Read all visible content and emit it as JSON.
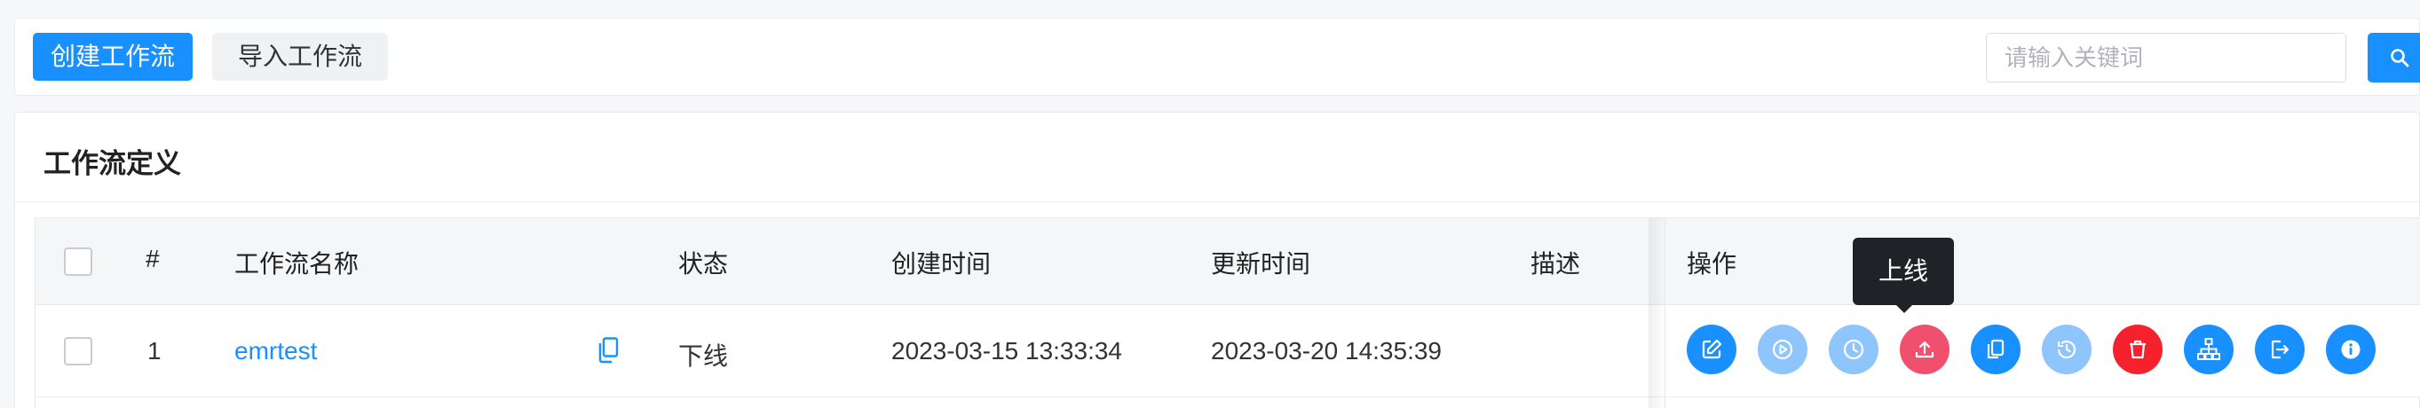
{
  "toolbar": {
    "create_label": "创建工作流",
    "import_label": "导入工作流",
    "search_placeholder": "请输入关键词",
    "search_value": ""
  },
  "card": {
    "title": "工作流定义"
  },
  "table": {
    "headers": {
      "index": "#",
      "name": "工作流名称",
      "status": "状态",
      "created": "创建时间",
      "updated": "更新时间",
      "description": "描述",
      "operations": "操作"
    },
    "rows": [
      {
        "index": "1",
        "name": "emrtest",
        "status": "下线",
        "created": "2023-03-15 13:33:34",
        "updated": "2023-03-20 14:35:39",
        "description": ""
      }
    ]
  },
  "operations": [
    {
      "name": "edit",
      "icon": "edit-icon",
      "color": "#1890ff"
    },
    {
      "name": "run",
      "icon": "play-icon",
      "color": "#8ec5fc"
    },
    {
      "name": "timing",
      "icon": "clock-icon",
      "color": "#8ec5fc"
    },
    {
      "name": "online",
      "icon": "upload-icon",
      "color": "#f0506e"
    },
    {
      "name": "copy",
      "icon": "copy-icon",
      "color": "#1890ff"
    },
    {
      "name": "version",
      "icon": "history-icon",
      "color": "#8ec5fc"
    },
    {
      "name": "delete",
      "icon": "trash-icon",
      "color": "#f5222d"
    },
    {
      "name": "tree-view",
      "icon": "sitemap-icon",
      "color": "#1890ff"
    },
    {
      "name": "export",
      "icon": "export-icon",
      "color": "#1890ff"
    },
    {
      "name": "info",
      "icon": "info-icon",
      "color": "#1890ff"
    }
  ],
  "tooltip": {
    "text": "上线"
  }
}
